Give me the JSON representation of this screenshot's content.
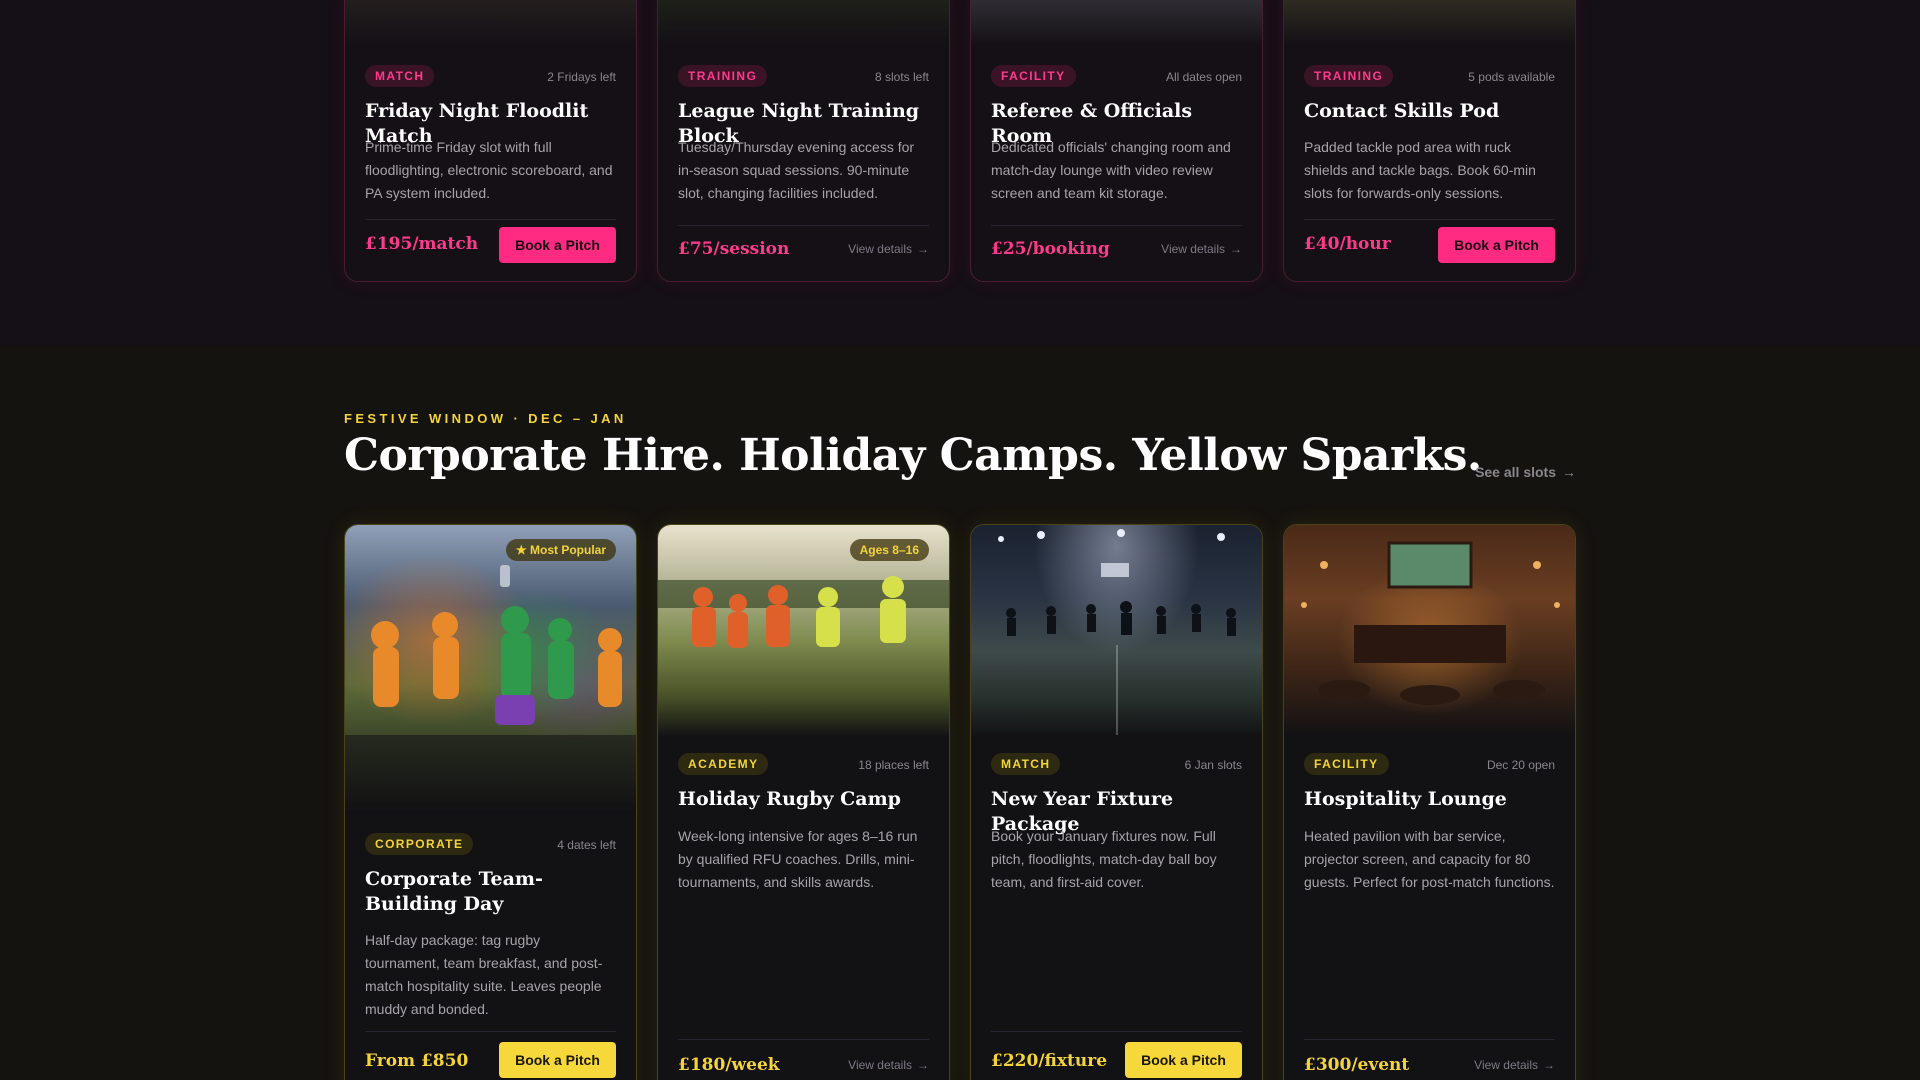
{
  "top_cards": [
    {
      "badge": "MATCH",
      "meta": "2 Fridays left",
      "title": "Friday Night Floodlit Match",
      "desc": "Prime-time Friday slot with full floodlighting, electronic scoreboard, and PA system included.",
      "price": "£195/match",
      "cta": "Book a Pitch"
    },
    {
      "badge": "TRAINING",
      "meta": "8 slots left",
      "title": "League Night Training Block",
      "desc": "Tuesday/Thursday evening access for in-season squad sessions. 90-minute slot, changing facilities included.",
      "price": "£75/session",
      "cta": "View details"
    },
    {
      "badge": "FACILITY",
      "meta": "All dates open",
      "title": "Referee & Officials Room",
      "desc": "Dedicated officials' changing room and match-day lounge with video review screen and team kit storage.",
      "price": "£25/booking",
      "cta": "View details"
    },
    {
      "badge": "TRAINING",
      "meta": "5 pods available",
      "title": "Contact Skills Pod",
      "desc": "Padded tackle pod area with ruck shields and tackle bags. Book 60-min slots for forwards-only sessions.",
      "price": "£40/hour",
      "cta": "Book a Pitch"
    }
  ],
  "festive": {
    "eyebrow": "FESTIVE WINDOW · DEC – JAN",
    "title": "Corporate Hire. Holiday Camps. Yellow Sparks.",
    "see_all": "See all slots",
    "arrow": "→"
  },
  "bottom_cards": [
    {
      "img_badge": "★ Most Popular",
      "badge": "CORPORATE",
      "meta": "4 dates left",
      "title": "Corporate Team-Building Day",
      "desc": "Half-day package: tag rugby tournament, team breakfast, and post-match hospitality suite. Leaves people muddy and bonded.",
      "price": "From £850",
      "cta": "Book a Pitch"
    },
    {
      "img_badge": "Ages 8–16",
      "badge": "ACADEMY",
      "meta": "18 places left",
      "title": "Holiday Rugby Camp",
      "desc": "Week-long intensive for ages 8–16 run by qualified RFU coaches. Drills, mini-tournaments, and skills awards.",
      "price": "£180/week",
      "cta": "View details"
    },
    {
      "badge": "MATCH",
      "meta": "6 Jan slots",
      "title": "New Year Fixture Package",
      "desc": "Book your January fixtures now. Full pitch, floodlights, match-day ball boy team, and first-aid cover.",
      "price": "£220/fixture",
      "cta": "Book a Pitch"
    },
    {
      "badge": "FACILITY",
      "meta": "Dec 20 open",
      "title": "Hospitality Lounge",
      "desc": "Heated pavilion with bar service, projector screen, and capacity for 80 guests. Perfect for post-match functions.",
      "price": "£300/event",
      "cta": "View details"
    }
  ],
  "colors": {
    "pink": "#ff2a82",
    "yellow": "#f7d83a"
  }
}
